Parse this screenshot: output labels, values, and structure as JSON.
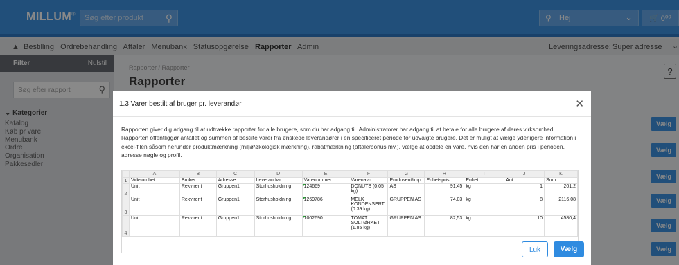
{
  "header": {
    "logo": "MILLUM",
    "logo_mark": "®",
    "search_placeholder": "Søg efter produkt",
    "greeting": "Hej",
    "cart_total": "0⁰⁰"
  },
  "nav": {
    "items": [
      "Bestilling",
      "Ordrebehandling",
      "Aftaler",
      "Menubank",
      "Statusopgørelse",
      "Rapporter",
      "Admin"
    ],
    "active": "Rapporter",
    "delivery_label": "Leveringsadresse:",
    "delivery_value": "Super adresse"
  },
  "sidebar": {
    "title": "Filter",
    "reset": "Nulstil",
    "search_placeholder": "Søg efter rapport",
    "categories_title": "Kategorier",
    "categories": [
      "Katalog",
      "Køb pr vare",
      "Menubank",
      "Ordre",
      "Organisation",
      "Pakkesedler"
    ]
  },
  "main": {
    "breadcrumb": "Rapporter / Rapporter",
    "title": "Rapporter",
    "help": "?",
    "row_button": "Vælg"
  },
  "modal": {
    "title": "1.3 Varer bestilt af bruger pr. leverandør",
    "description": "Rapporten giver dig adgang til at udtrække rapporter for alle brugere, som du har adgang til. Administratorer har adgang til at betale for alle brugere af deres virksomhed. Rapporten offentliggør antallet og summen af bestilte varer fra ønskede leverandører i en specificeret periode for udvalgte brugere. Det er muligt at vælge yderligere information i excel-filen såsom herunder produktmærkning (miljø/økologisk mærkning), rabatmærkning (aftale/bonus mv.), vælge at opdele en vare, hvis den har en anden pris i perioden, adresse nøgle og profil.",
    "cancel_label": "Luk",
    "confirm_label": "Vælg",
    "sheet": {
      "columns": [
        "A",
        "B",
        "C",
        "D",
        "E",
        "F",
        "G",
        "H",
        "I",
        "J",
        "K"
      ],
      "headers": [
        "Virksomhet",
        "Bruker",
        "Adresse",
        "Leverandør",
        "Varenummer",
        "Varenavn",
        "Produsent/imp.",
        "Enhetspris",
        "Enhet",
        "Ant.",
        "Sum"
      ],
      "rows": [
        [
          "Unit",
          "Rekvirent",
          "Gruppen1",
          "Storhusholdning",
          "124669",
          "DONUTS (0.05 kg)",
          "AS",
          "91,45",
          "kg",
          "1",
          "201,2"
        ],
        [
          "Unit",
          "Rekvirent",
          "Gruppen1",
          "Storhusholdning",
          "1269786",
          "MELK KONDENSERT (0.39 kg)",
          "GRUPPEN AS",
          "74,03",
          "kg",
          "8",
          "2116,08"
        ],
        [
          "Unit",
          "Rekvirent",
          "Gruppen1",
          "Storhusholdning",
          "1002690",
          "TOMAT SOLTØRKET (1.85 kg)",
          "GRUPPEN AS",
          "82,53",
          "kg",
          "10",
          "4580,4"
        ]
      ]
    }
  }
}
